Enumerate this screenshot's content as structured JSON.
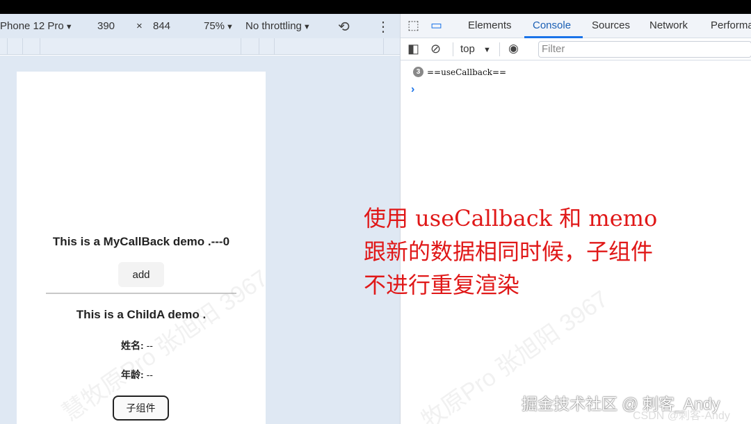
{
  "device_toolbar": {
    "device": "Phone 12 Pro",
    "width": "390",
    "times": "×",
    "height": "844",
    "zoom": "75%",
    "throttling": "No throttling"
  },
  "devtools": {
    "tabs": [
      "Elements",
      "Console",
      "Sources",
      "Network",
      "Performa"
    ],
    "active_tab": "Console",
    "context": "top",
    "filter_placeholder": "Filter",
    "log": {
      "count": "3",
      "message": "==useCallback=="
    },
    "prompt": "›"
  },
  "page": {
    "callback_title": "This is a MyCallBack demo .---0",
    "add_button": "add",
    "child_title": "This is a ChildA demo .",
    "name_label": "姓名:",
    "name_value": "--",
    "age_label": "年龄:",
    "age_value": "--",
    "child_button": "子组件"
  },
  "annotation": {
    "line1": "使用 useCallback  和 memo",
    "line2": "跟新的数据相同时候，子组件",
    "line3": "不进行重复渲染"
  },
  "footer": {
    "juejin": "掘金技术社区 @ 刺客_Andy",
    "csdn": "CSDN @刺客-Andy"
  },
  "colors": {
    "annotation": "#e01818",
    "active_tab": "#1a5fb4",
    "toolbar_bg": "#dfe8f3"
  }
}
